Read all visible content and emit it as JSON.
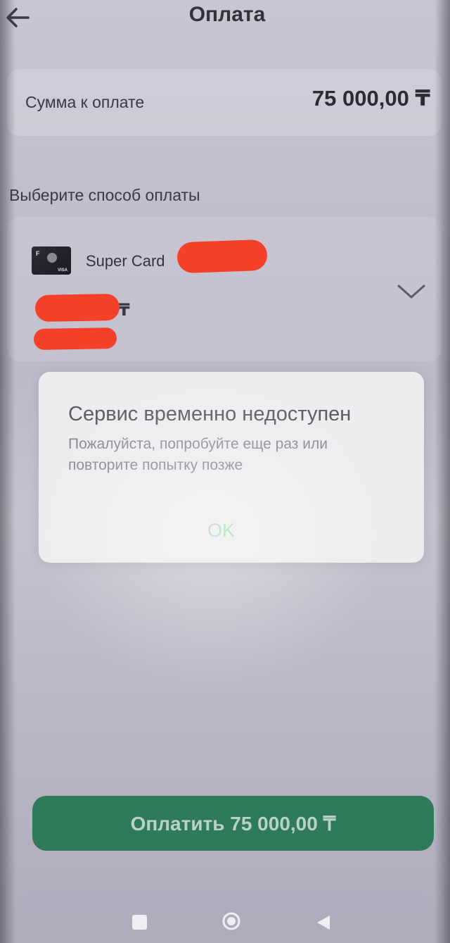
{
  "header": {
    "title": "Оплата",
    "back_icon": "arrow-left-icon"
  },
  "amount": {
    "label": "Сумма к оплате",
    "value": "75 000,00 ₸"
  },
  "payment_method": {
    "section_label": "Выберите способ оплаты",
    "card_name": "Super Card",
    "card_logo": "F",
    "card_network": "VISA",
    "balance_suffix": "₸",
    "limit_suffix": "₸",
    "expand_icon": "chevron-down-icon"
  },
  "dialog": {
    "title": "Сервис временно недоступен",
    "message": "Пожалуйста, попробуйте еще раз или повторите попытку позже",
    "ok_label": "OK"
  },
  "pay_button": {
    "label": "Оплатить 75 000,00 ₸"
  },
  "nav_bar": {
    "recent_icon": "square-icon",
    "home_icon": "circle-icon",
    "back_icon": "triangle-back-icon"
  },
  "colors": {
    "accent": "#2e7a59",
    "ok_text": "#a6d9b4",
    "redaction": "#f5402a"
  }
}
